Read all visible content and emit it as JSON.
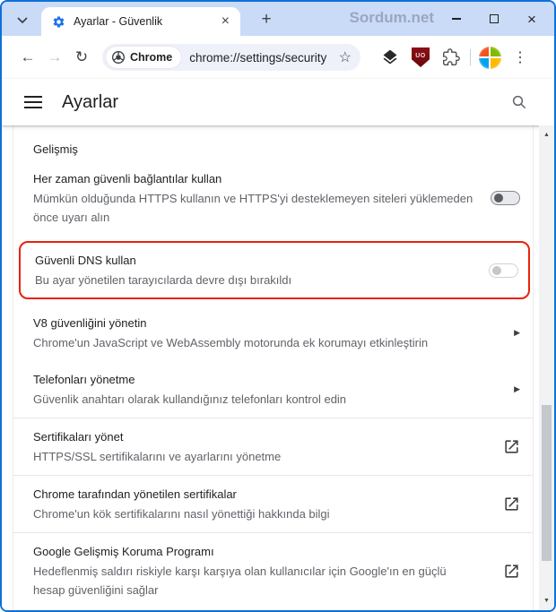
{
  "colors": {
    "window_border_blue": "#0e70d8",
    "titlebar_bg": "#cadbf7",
    "accent_blue": "#1a73e8",
    "highlight_red": "#e8220d",
    "ublock_red": "#7b0e12",
    "text_primary": "#202124",
    "text_secondary": "#5f6368"
  },
  "titlebar": {
    "tab_title": "Ayarlar - Güvenlik",
    "watermark": "Sordum.net",
    "tab_close_glyph": "×",
    "newtab_glyph": "+",
    "window_close_glyph": "×"
  },
  "toolbar": {
    "back_glyph": "←",
    "forward_glyph": "→",
    "reload_glyph": "↻",
    "chip_label": "Chrome",
    "url": "chrome://settings/security",
    "star_glyph": "☆",
    "ublock_label": "UO",
    "kebab_glyph": "⋮"
  },
  "settings_header": {
    "title": "Ayarlar"
  },
  "content": {
    "section_label": "Gelişmiş",
    "rows": [
      {
        "label": "Her zaman güvenli bağlantılar kullan",
        "sublabel": "Mümkün olduğunda HTTPS kullanın ve HTTPS'yi desteklemeyen siteleri yüklemeden önce uyarı alın",
        "control": "toggle-off"
      },
      {
        "label": "Güvenli DNS kullan",
        "sublabel": "Bu ayar yönetilen tarayıcılarda devre dışı bırakıldı",
        "control": "toggle-disabled",
        "highlighted": true
      },
      {
        "label": "V8 güvenliğini yönetin",
        "sublabel": "Chrome'un JavaScript ve WebAssembly motorunda ek korumayı etkinleştirin",
        "control": "subpage-arrow"
      },
      {
        "label": "Telefonları yönetme",
        "sublabel": "Güvenlik anahtarı olarak kullandığınız telefonları kontrol edin",
        "control": "subpage-arrow"
      },
      {
        "label": "Sertifikaları yönet",
        "sublabel": "HTTPS/SSL sertifikalarını ve ayarlarını yönetme",
        "control": "external-link"
      },
      {
        "label": "Chrome tarafından yönetilen sertifikalar",
        "sublabel": "Chrome'un kök sertifikalarını nasıl yönettiği hakkında bilgi",
        "control": "external-link"
      },
      {
        "label": "Google Gelişmiş Koruma Programı",
        "sublabel": "Hedeflenmiş saldırı riskiyle karşı karşıya olan kullanıcılar için Google'ın en güçlü hesap güvenliğini sağlar",
        "control": "external-link"
      }
    ]
  },
  "scrollbar": {
    "up_glyph": "▲",
    "down_glyph": "▼",
    "subpage_arrow_glyph": "▶"
  }
}
